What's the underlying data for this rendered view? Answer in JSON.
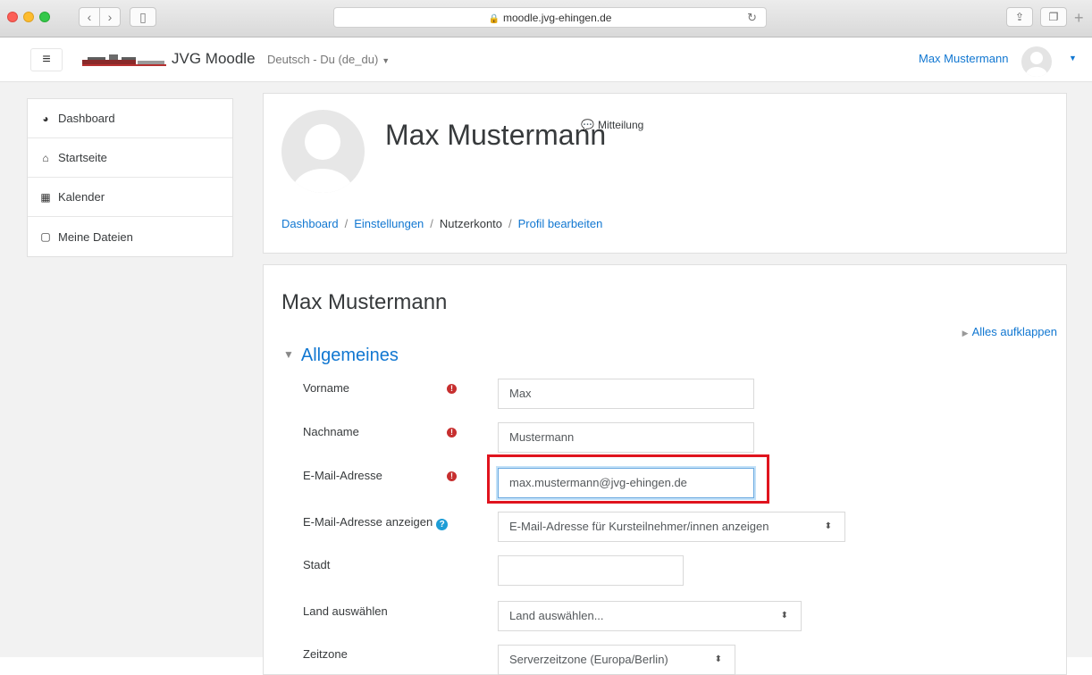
{
  "browser": {
    "url": "moodle.jvg-ehingen.de",
    "nav": {
      "back": "‹",
      "forward": "›"
    }
  },
  "navbar": {
    "site_name": "JVG Moodle",
    "language": "Deutsch - Du (de_du)",
    "user_name": "Max Mustermann"
  },
  "drawer": {
    "items": [
      {
        "label": "Dashboard",
        "icon": "dashboard-icon"
      },
      {
        "label": "Startseite",
        "icon": "home-icon"
      },
      {
        "label": "Kalender",
        "icon": "calendar-icon"
      },
      {
        "label": "Meine Dateien",
        "icon": "file-icon"
      }
    ]
  },
  "header": {
    "name": "Max Mustermann",
    "message_label": "Mitteilung",
    "breadcrumb": [
      "Dashboard",
      "Einstellungen",
      "Nutzerkonto",
      "Profil bearbeiten"
    ]
  },
  "form": {
    "title": "Max Mustermann",
    "expand_all": "Alles aufklappen",
    "section": "Allgemeines",
    "fields": {
      "firstname": {
        "label": "Vorname",
        "value": "Max"
      },
      "lastname": {
        "label": "Nachname",
        "value": "Mustermann"
      },
      "email": {
        "label": "E-Mail-Adresse",
        "value": "max.mustermann@jvg-ehingen.de"
      },
      "maildisplay": {
        "label": "E-Mail-Adresse anzeigen",
        "value": "E-Mail-Adresse für Kursteilnehmer/innen anzeigen"
      },
      "city": {
        "label": "Stadt",
        "value": ""
      },
      "country": {
        "label": "Land auswählen",
        "value": "Land auswählen..."
      },
      "timezone": {
        "label": "Zeitzone",
        "value": "Serverzeitzone (Europa/Berlin)"
      }
    }
  },
  "colors": {
    "link": "#1177d1",
    "required": "#c72f2f",
    "highlight": "#e0141e"
  }
}
